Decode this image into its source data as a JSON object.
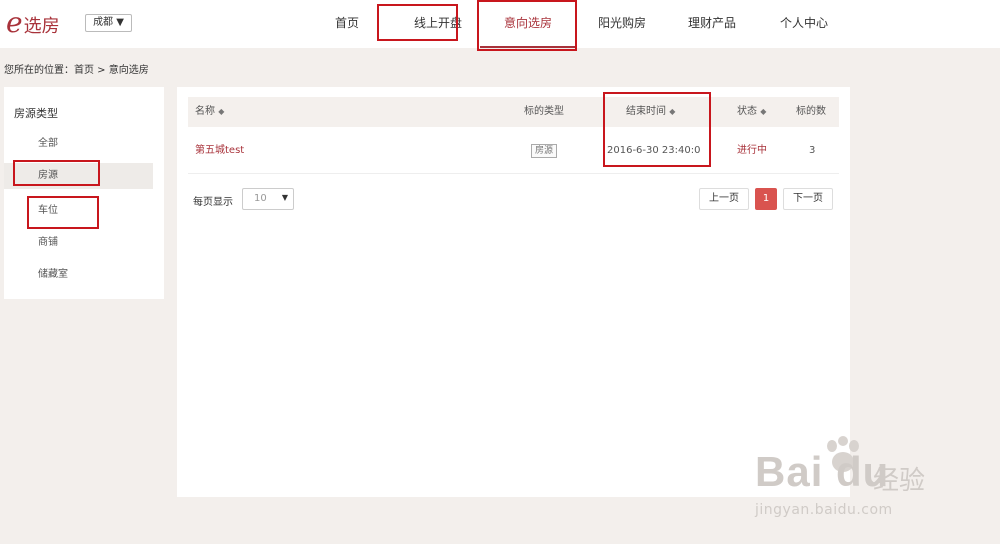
{
  "header": {
    "logo_e": "e",
    "logo_text": "选房",
    "city": "成都 ▼",
    "nav": [
      {
        "label": "首页"
      },
      {
        "label": "线上开盘"
      },
      {
        "label": "意向选房"
      },
      {
        "label": "阳光购房"
      },
      {
        "label": "理财产品"
      },
      {
        "label": "个人中心"
      }
    ],
    "active_nav": "意向选房"
  },
  "breadcrumb": "您所在的位置：首页 > 意向选房",
  "sidebar": {
    "title": "房源类型",
    "items": [
      {
        "label": "全部"
      },
      {
        "label": "房源"
      },
      {
        "label": "车位"
      },
      {
        "label": "商铺"
      },
      {
        "label": "储藏室"
      }
    ],
    "active": "房源"
  },
  "table": {
    "headers": {
      "name": "名称",
      "type": "标的类型",
      "end_time": "结束时间",
      "status": "状态",
      "count": "标的数"
    },
    "sort_icon": "sort-icon",
    "rows": [
      {
        "name": "第五城test",
        "type": "房源",
        "end_time": "2016-6-30 23:40:0",
        "status": "进行中",
        "count": "3"
      }
    ]
  },
  "pagination": {
    "per_page_label": "每页显示",
    "per_page_value": "10",
    "prev": "上一页",
    "current": "1",
    "next": "下一页"
  },
  "watermark": {
    "main": "Bai du",
    "cn": "经验",
    "url": "jingyan.baidu.com"
  },
  "colors": {
    "brand": "#a8323a",
    "highlight": "#c8161d",
    "page_bg": "#f3efec",
    "current_page": "#d9534f"
  }
}
